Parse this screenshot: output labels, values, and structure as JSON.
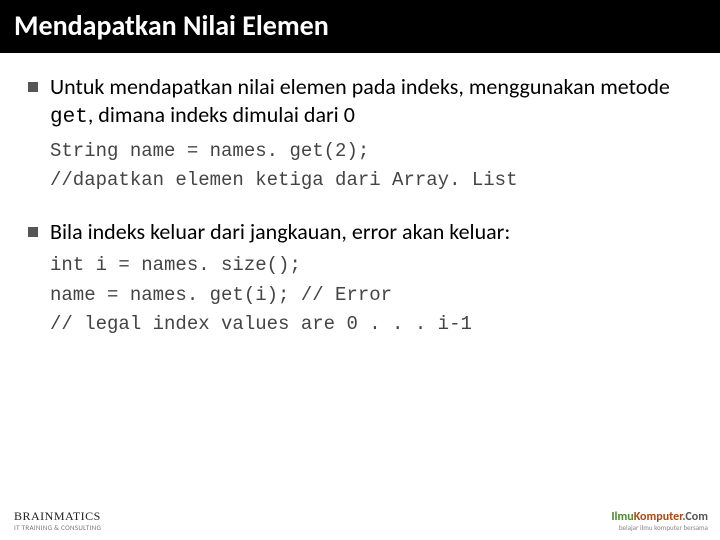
{
  "header": {
    "title": "Mendapatkan Nilai Elemen"
  },
  "body": {
    "bullet1_pre": "Untuk mendapatkan nilai elemen pada indeks, menggunakan metode ",
    "bullet1_code": "get",
    "bullet1_post": ", dimana indeks dimulai dari 0",
    "code1": "String name = names. get(2);\n//dapatkan elemen ketiga dari Array. List",
    "bullet2": "Bila indeks keluar dari jangkauan, error akan keluar:",
    "code2": "int i = names. size();\nname = names. get(i); // Error\n// legal index values are 0 . . . i-1"
  },
  "footer": {
    "left_brand": "BRAINMATICS",
    "left_sub": "IT TRAINING & CONSULTING",
    "right_ilmu": "Ilmu",
    "right_komp": "Komputer",
    "right_com": ".Com",
    "right_tag": "belajar ilmu komputer bersama"
  }
}
